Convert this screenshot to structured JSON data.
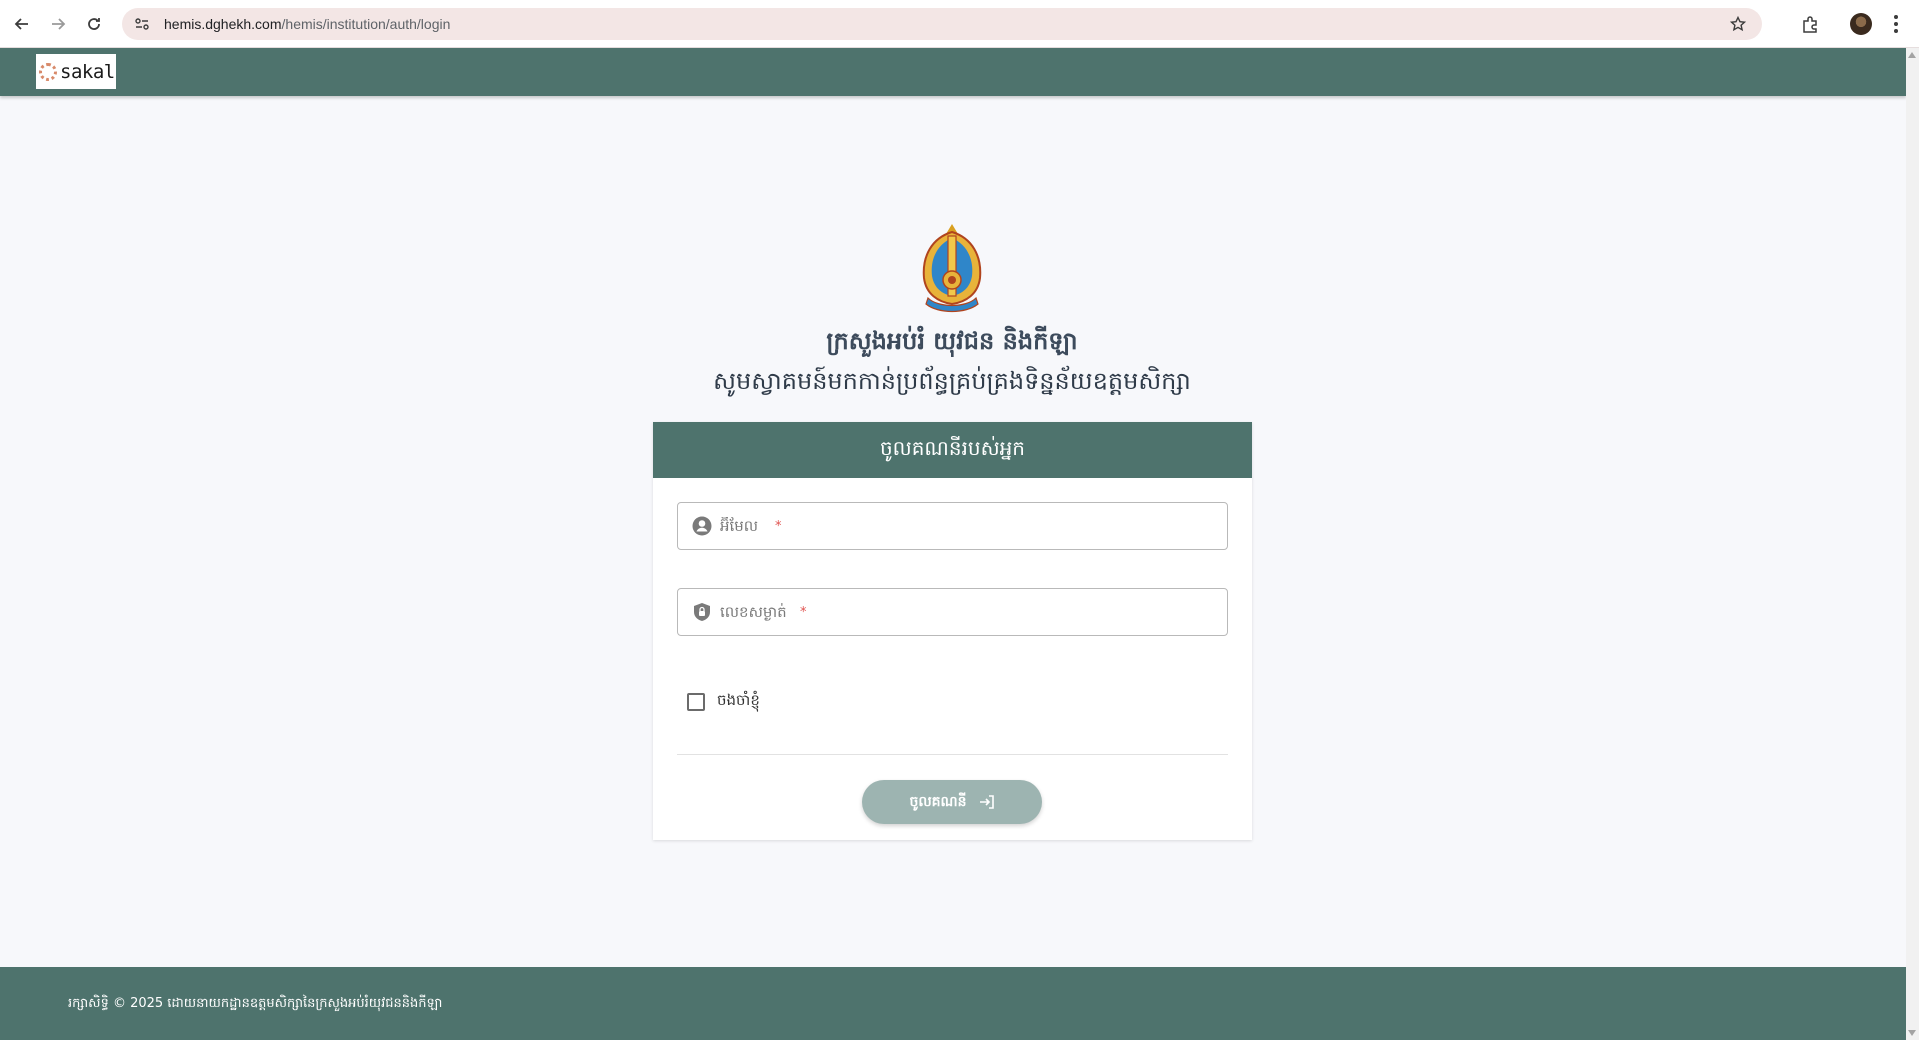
{
  "browser": {
    "url_host": "hemis.dghekh.com",
    "url_path": "/hemis/institution/auth/login"
  },
  "header": {
    "logo_text": "sakal"
  },
  "main": {
    "ministry_title": "ក្រសួងអប់រំ យុវជន និងកីឡា",
    "welcome_text": "សូមស្វាគមន៍មកកាន់ប្រព័ន្ធគ្រប់គ្រងទិន្នន័យឧត្តមសិក្សា"
  },
  "login_card": {
    "title": "ចូលគណនីរបស់អ្នក",
    "email_placeholder": "អ៊ីមែល",
    "password_placeholder": "លេខសម្ងាត់",
    "required_marker": "*",
    "remember_label": "ចងចាំខ្ញុំ",
    "submit_label": "ចូលគណនី"
  },
  "footer": {
    "copyright": "រក្សាសិទ្ធិ © 2025 ដោយនាយកដ្ឋានឧត្តមសិក្សានៃក្រសួងអប់រំយុវជននិងកីឡា"
  },
  "colors": {
    "primary": "#4e736d",
    "button_disabled": "#9db4b1",
    "required": "#e0524f"
  }
}
